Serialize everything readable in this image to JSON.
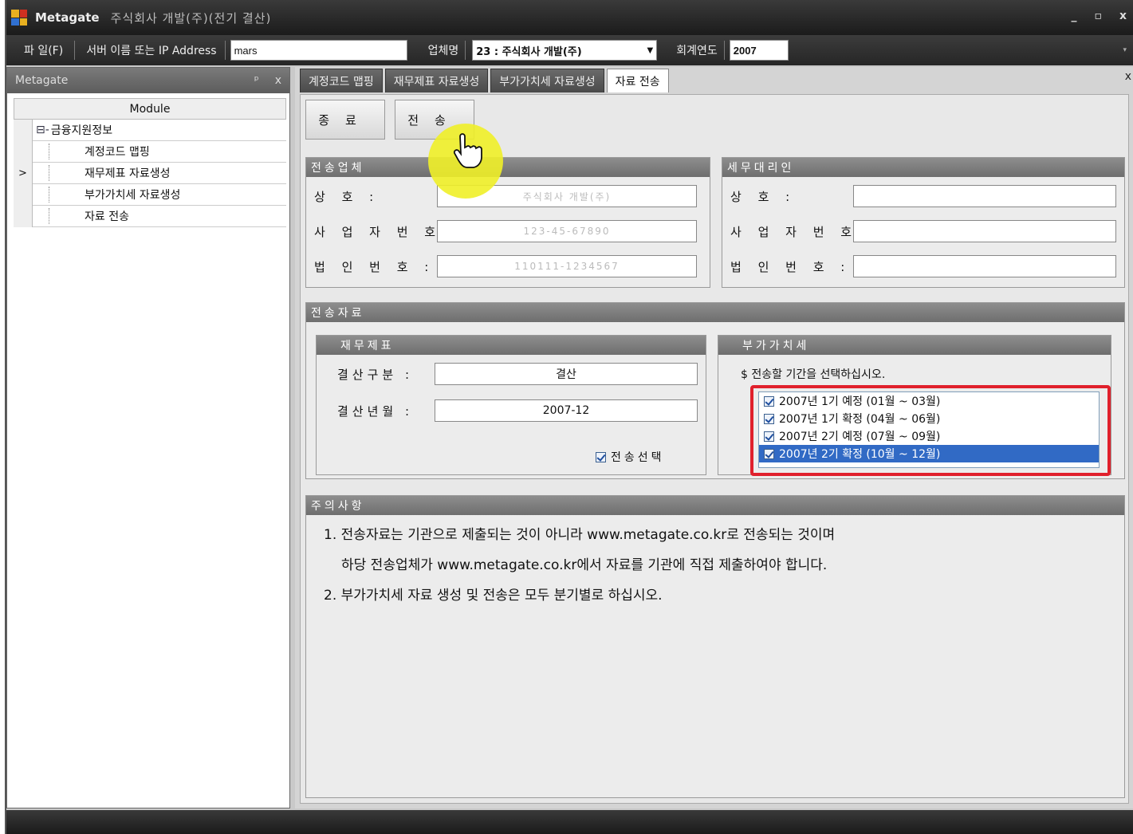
{
  "window": {
    "app_title": "Metagate",
    "doc_title": "주식회사 개발(주)(전기 결산)",
    "controls": [
      "_",
      "▫",
      "x"
    ]
  },
  "toolbar": {
    "file_menu": "파 일(F)",
    "server_label": "서버 이름 또는 IP Address",
    "server_value": "mars",
    "company_label": "업체명",
    "company_value": "23 : 주식회사 개발(주)",
    "year_label": "회계연도",
    "year_value": "2007"
  },
  "left_panel": {
    "title": "Metagate",
    "pin": "ᵖ",
    "close": "x",
    "column_header": "Module",
    "tree": [
      {
        "label": "금융지원정보",
        "prefix": "⊟-",
        "current": false
      },
      {
        "label": "계정코드 맵핑",
        "prefix": "",
        "current": false
      },
      {
        "label": "재무제표 자료생성",
        "prefix": "",
        "current": true
      },
      {
        "label": "부가가치세 자료생성",
        "prefix": "",
        "current": false
      },
      {
        "label": "자료 전송",
        "prefix": "",
        "current": false
      }
    ],
    "row_marker": ">"
  },
  "tabs": [
    {
      "label": "계정코드 맵핑",
      "active": false
    },
    {
      "label": "재무제표 자료생성",
      "active": false
    },
    {
      "label": "부가가치세 자료생성",
      "active": false
    },
    {
      "label": "자료 전송",
      "active": true
    }
  ],
  "tab_close": "x",
  "buttons": {
    "close": "종료",
    "send": "전송"
  },
  "sender": {
    "title": "전송업체",
    "fields": [
      {
        "label": "상 호 :",
        "value": "주식회사 개발(주)"
      },
      {
        "label": "사 업 자 번 호 :",
        "value": "123-45-67890"
      },
      {
        "label": "법 인 번 호 :",
        "value": "110111-1234567"
      }
    ]
  },
  "agent": {
    "title": "세무대리인",
    "fields": [
      {
        "label": "상 호 :",
        "value": ""
      },
      {
        "label": "사 업 자 번 호 :",
        "value": ""
      },
      {
        "label": "법 인 번 호 :",
        "value": ""
      }
    ]
  },
  "transfer": {
    "title": "전송자료",
    "financial": {
      "title": "재무제표",
      "fields": [
        {
          "label": "결산구분 :",
          "value": "결산"
        },
        {
          "label": "결산년월 :",
          "value": "2007-12"
        }
      ],
      "checkbox_label": "전송선택",
      "checked": true
    },
    "vat": {
      "title": "부가가치세",
      "instruction": "$ 전송할 기간을 선택하십시오.",
      "periods": [
        {
          "label": "2007년 1기 예정 (01월 ~ 03월)",
          "checked": true,
          "selected": false
        },
        {
          "label": "2007년 1기 확정 (04월 ~ 06월)",
          "checked": true,
          "selected": false
        },
        {
          "label": "2007년 2기 예정 (07월 ~ 09월)",
          "checked": true,
          "selected": false
        },
        {
          "label": "2007년 2기 확정 (10월 ~ 12월)",
          "checked": true,
          "selected": true
        }
      ]
    }
  },
  "notice": {
    "title": "주의사항",
    "lines": [
      "1. 전송자료는 기관으로 제출되는 것이 아니라 www.metagate.co.kr로 전송되는 것이며",
      "하당 전송업체가 www.metagate.co.kr에서 자료를 기관에 직접 제출하여야 합니다.",
      "2. 부가가치세 자료 생성 및 전송은 모두 분기별로 하십시오."
    ]
  },
  "colors": {
    "highlight": "#316ac5",
    "red_frame": "#e0202c",
    "cursor_halo": "#f0f028"
  },
  "icons": {
    "app": "app-grid-icon",
    "cursor": "hand-pointer-icon"
  }
}
